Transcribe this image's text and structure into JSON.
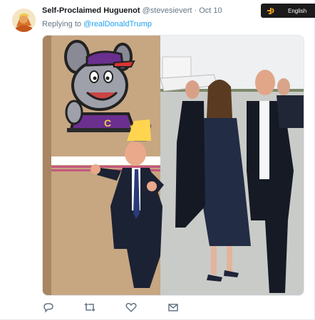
{
  "tweet": {
    "display_name": "Self-Proclaimed Huguenot",
    "handle": "@stevesievert",
    "separator": "·",
    "timestamp": "Oct 10",
    "reply_prefix": "Replying to",
    "reply_to": "@realDonaldTrump"
  },
  "language_selector": {
    "label": "English"
  },
  "actions": [
    {
      "name": "reply",
      "icon": "reply-icon"
    },
    {
      "name": "retweet",
      "icon": "retweet-icon"
    },
    {
      "name": "like",
      "icon": "heart-icon"
    },
    {
      "name": "message",
      "icon": "envelope-icon"
    }
  ],
  "colors": {
    "link": "#1da1f2",
    "secondary_text": "#657786",
    "primary_text": "#14171a",
    "icon": "#657786"
  }
}
